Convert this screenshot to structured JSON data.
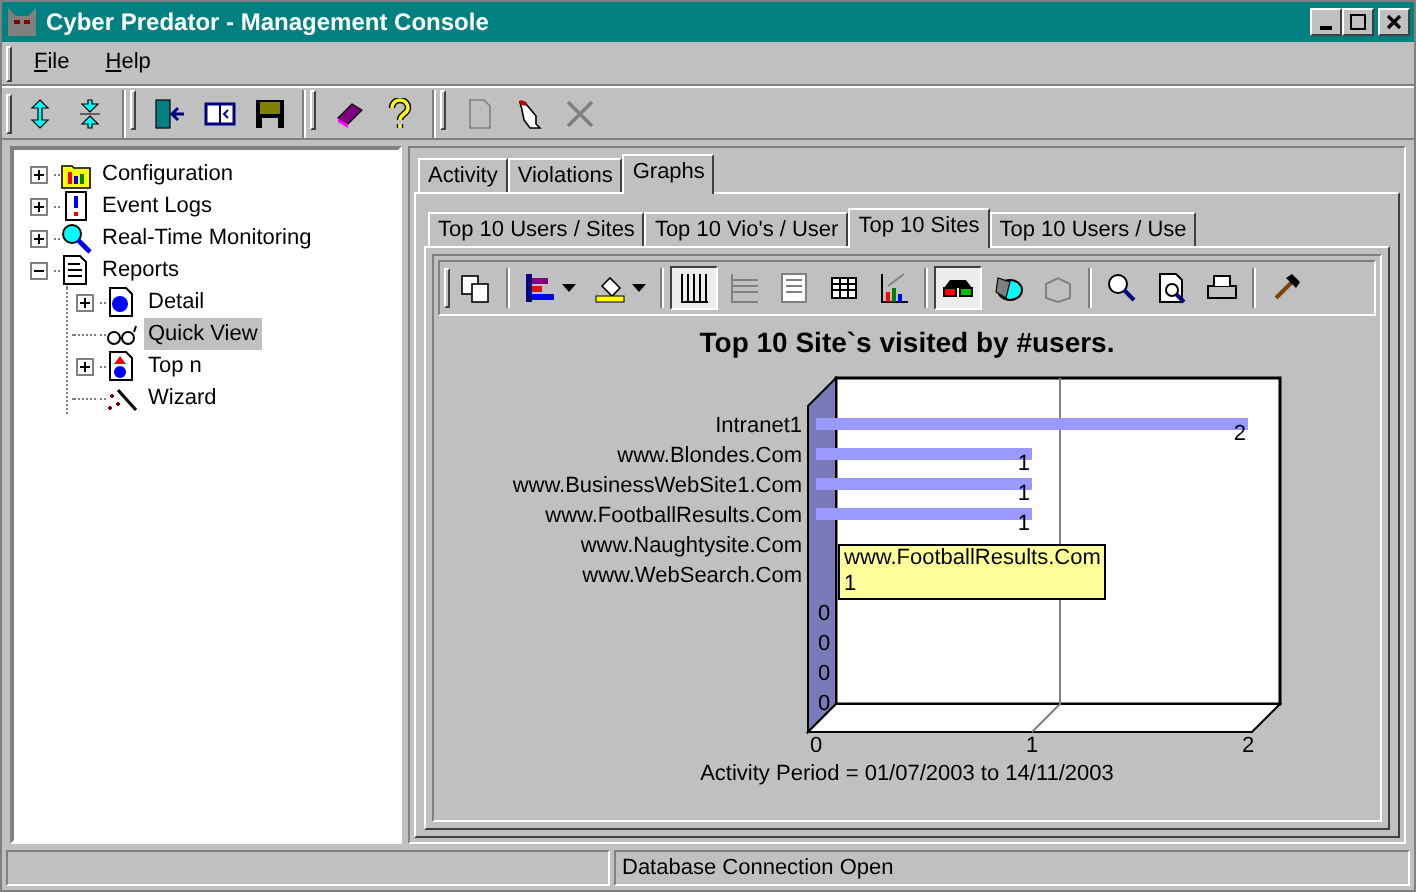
{
  "window": {
    "title": "Cyber Predator - Management Console"
  },
  "menu": [
    {
      "label": "File",
      "underline_first": true
    },
    {
      "label": "Help",
      "underline_first": true
    }
  ],
  "toolbar": [
    {
      "kind": "expand",
      "disabled": false
    },
    {
      "kind": "collapse",
      "disabled": false
    },
    {
      "kind": "separator"
    },
    {
      "kind": "exit",
      "disabled": false
    },
    {
      "kind": "panel",
      "disabled": false
    },
    {
      "kind": "save",
      "disabled": false
    },
    {
      "kind": "separator"
    },
    {
      "kind": "book",
      "disabled": false
    },
    {
      "kind": "help",
      "disabled": false
    },
    {
      "kind": "separator"
    },
    {
      "kind": "new",
      "disabled": true
    },
    {
      "kind": "pointer",
      "disabled": false
    },
    {
      "kind": "delete",
      "disabled": true
    }
  ],
  "tree": [
    {
      "label": "Configuration",
      "kind": "config",
      "expandable": true,
      "expanded": false,
      "selected": false
    },
    {
      "label": "Event Logs",
      "kind": "log",
      "expandable": true,
      "expanded": false,
      "selected": false
    },
    {
      "label": "Real-Time Monitoring",
      "kind": "monitor",
      "expandable": true,
      "expanded": false,
      "selected": false
    },
    {
      "label": "Reports",
      "kind": "reports",
      "expandable": true,
      "expanded": true,
      "selected": false,
      "children": [
        {
          "label": "Detail",
          "kind": "detail",
          "expandable": true,
          "expanded": false,
          "selected": false
        },
        {
          "label": "Quick View",
          "kind": "quickview",
          "expandable": false,
          "expanded": false,
          "selected": true
        },
        {
          "label": "Top n",
          "kind": "topn",
          "expandable": true,
          "expanded": false,
          "selected": false
        },
        {
          "label": "Wizard",
          "kind": "wizard",
          "expandable": false,
          "expanded": false,
          "selected": false
        }
      ]
    }
  ],
  "tabs": [
    {
      "label": "Activity",
      "selected": false
    },
    {
      "label": "Violations",
      "selected": false
    },
    {
      "label": "Graphs",
      "selected": true
    }
  ],
  "subtabs": [
    {
      "label": "Top 10 Users / Sites",
      "selected": false
    },
    {
      "label": "Top 10 Vio's / User",
      "selected": false
    },
    {
      "label": "Top 10 Sites",
      "selected": true
    },
    {
      "label": "Top 10 Users / Use",
      "selected": false
    }
  ],
  "chart_toolbar": [
    {
      "kind": "copy",
      "pressed": false
    },
    {
      "kind": "separator"
    },
    {
      "kind": "gallery",
      "pressed": false
    },
    {
      "kind": "color",
      "pressed": false
    },
    {
      "kind": "separator"
    },
    {
      "kind": "vgrid",
      "pressed": true
    },
    {
      "kind": "hgrid",
      "pressed": false
    },
    {
      "kind": "legend",
      "pressed": false
    },
    {
      "kind": "datagrid",
      "pressed": false
    },
    {
      "kind": "trend",
      "pressed": false
    },
    {
      "kind": "separator"
    },
    {
      "kind": "anaglyph",
      "pressed": true
    },
    {
      "kind": "rotate",
      "pressed": false
    },
    {
      "kind": "zclust",
      "pressed": false
    },
    {
      "kind": "separator"
    },
    {
      "kind": "zoom",
      "pressed": false
    },
    {
      "kind": "preview",
      "pressed": false
    },
    {
      "kind": "print",
      "pressed": false
    },
    {
      "kind": "separator"
    },
    {
      "kind": "tools",
      "pressed": false
    }
  ],
  "chart_data": {
    "type": "bar",
    "orientation": "horizontal",
    "title": "Top 10 Site`s visited by #users.",
    "xlabel": "Activity Period = 01/07/2003 to 14/11/2003",
    "categories": [
      "Intranet1",
      "www.Blondes.Com",
      "www.BusinessWebSite1.Com",
      "www.FootballResults.Com",
      "www.Naughtysite.Com",
      "www.WebSearch.Com",
      null,
      null,
      null,
      null
    ],
    "series": [
      {
        "color": "#9999ff",
        "values": [
          2,
          1,
          1,
          1,
          null,
          null,
          0,
          0,
          0,
          0
        ]
      }
    ],
    "xlim": [
      0,
      2
    ],
    "xticks": [
      0,
      1,
      2
    ],
    "value_labels": [
      "2",
      "1",
      "1",
      "1",
      null,
      null,
      "0",
      "0",
      "0",
      "0"
    ]
  },
  "tooltip": {
    "lines": [
      "www.FootballResults.Com",
      "1"
    ]
  },
  "status_bar": {
    "message": "Database Connection Open"
  }
}
